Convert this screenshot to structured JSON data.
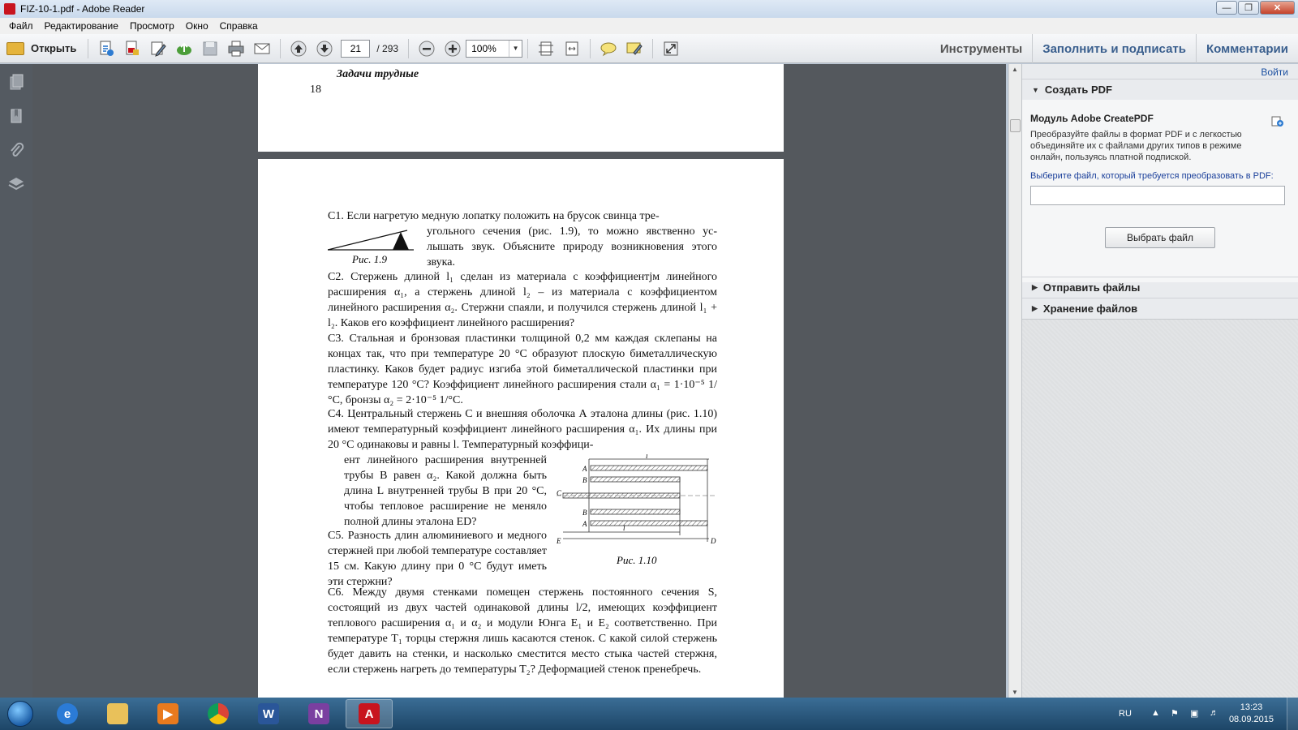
{
  "window": {
    "title": "FIZ-10-1.pdf - Adobe Reader"
  },
  "menu": [
    "Файл",
    "Редактирование",
    "Просмотр",
    "Окно",
    "Справка"
  ],
  "toolbar": {
    "open_label": "Открыть",
    "current_page": "21",
    "total_pages": "/ 293",
    "zoom": "100%",
    "tabs": [
      "Инструменты",
      "Заполнить и подписать",
      "Комментарии"
    ]
  },
  "document": {
    "page1": {
      "heading": "Задачи трудные",
      "page_number": "18"
    },
    "c1": {
      "line1": "C1.  Если  нагретую медную лопатку  положить на брусок свинца тре-",
      "rest": "угольного сечения (рис. 1.9), то можно явственно ус-лышать звук. Объясните природу возникновения этого звука.",
      "caption": "Рис. 1.9"
    },
    "c2": "C2.  Стержень длиной l₁ сделан из материала с коэффициентjм линейного расширения α₁, а стержень длиной  l₂ – из материала с коэффициентом линейного расширения α₂. Стержни спаяли, и получился стержень длиной l₁ + l₂. Каков его коэффициент линейного расширения?",
    "c3": "C3. Стальная  и бронзовая  пластинки толщиной 0,2 мм  каждая склепаны на  концах так, что при температуре 20 °С образуют плоскую биметаллическую пластинку. Каков будет радиус изгиба этой биметаллической пластинки при температуре 120 °С? Коэффициент линейного расширения стали α₁ = 1·10⁻⁵ 1/°C, бронзы α₂ = 2·10⁻⁵ 1/°C.",
    "c4_top": "C4. Центральный стержень С и внешняя оболочка А эталона длины (рис. 1.10) имеют температурный коэффициент линейного расширения α₁. Их длины при 20 °С одинаковы и равны l. Температурный коэффици-",
    "c4_bottom": "ент линейного расширения внутренней трубы В равен α₂. Какой должна быть длина L внутренней трубы В при 20 °С, чтобы тепловое расширение не меняло полной длины эталона ED?",
    "c5": "C5. Разность длин алюминиевого и медного стержней при любой температуре составляет 15 см. Какую длину при 0 °С будут иметь эти стержни?",
    "fig110_caption": "Рис. 1.10",
    "fig110_labels": {
      "A": "A",
      "B": "B",
      "C": "C",
      "E": "E",
      "D": "D",
      "l": "l"
    },
    "c6": "C6. Между двумя стенками помещен стержень постоянного сечения S, состоящий из двух частей одинаковой длины l/2, имеющих коэффициент теплового расширения α₁ и α₂ и модули Юнга E₁ и E₂ соответственно. При температуре T₁ торцы стержня лишь касаются стенок. С какой силой стержень будет давить на стенки, и насколько сместится место стыка частей стержня, если стержень нагреть до температуры T₂?  Деформацией стенок пренебречь."
  },
  "right_pane": {
    "login": "Войти",
    "create_pdf": "Создать PDF",
    "module_title": "Модуль Adobe CreatePDF",
    "module_desc": "Преобразуйте файлы в формат PDF и с легкостью объединяйте их с файлами других типов в режиме онлайн, пользуясь платной подпиской.",
    "select_prompt": "Выберите файл, который требуется преобразовать в PDF:",
    "choose_button": "Выбрать файл",
    "send_files": "Отправить файлы",
    "store_files": "Хранение файлов"
  },
  "taskbar": {
    "lang": "RU",
    "time": "13:23",
    "date": "08.09.2015"
  },
  "colors": {
    "title_gradient_top": "#dfe9f5",
    "doc_bg": "#54585d",
    "accent_blue": "#1a3f9a",
    "close_red": "#c4422a"
  }
}
